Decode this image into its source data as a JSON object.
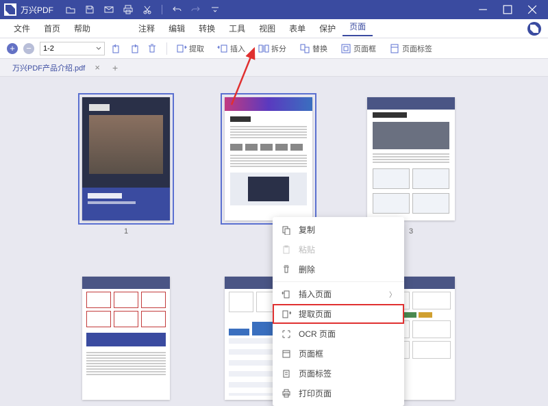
{
  "app": {
    "title": "万兴PDF"
  },
  "menus": {
    "file": "文件",
    "home": "首页",
    "help": "帮助",
    "annotate": "注释",
    "edit": "编辑",
    "convert": "转换",
    "tools": "工具",
    "view": "视图",
    "forms": "表单",
    "protect": "保护",
    "pages": "页面"
  },
  "toolbar": {
    "range": "1-2",
    "extract": "提取",
    "insert": "插入",
    "split": "拆分",
    "replace": "替换",
    "pagebox": "页面框",
    "labels": "页面标签"
  },
  "tab": {
    "name": "万兴PDF产品介绍.pdf"
  },
  "pagenums": {
    "p1": "1",
    "p3": "3"
  },
  "context": {
    "copy": "复制",
    "paste": "粘贴",
    "delete": "删除",
    "insert_pages": "插入页面",
    "extract_pages": "提取页面",
    "ocr_pages": "OCR 页面",
    "page_box": "页面框",
    "page_labels": "页面标签",
    "print_pages": "打印页面"
  }
}
